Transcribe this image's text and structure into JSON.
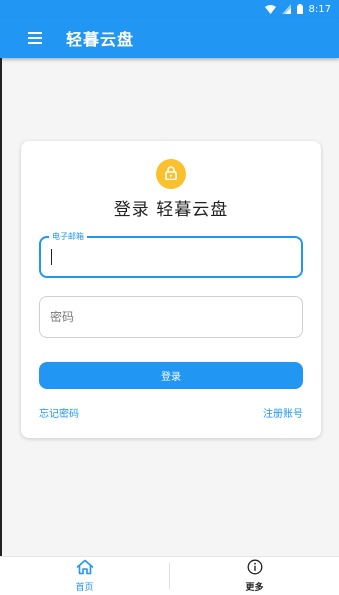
{
  "status_bar": {
    "time": "8:17",
    "icons": [
      "wifi-icon",
      "signal-icon",
      "battery-icon"
    ]
  },
  "app_bar": {
    "title": "轻暮云盘",
    "menu_icon": "menu-icon"
  },
  "login_card": {
    "lock_icon": "lock-icon",
    "title": "登录 轻暮云盘",
    "email": {
      "label": "电子邮箱",
      "value": ""
    },
    "password": {
      "placeholder": "密码",
      "value": ""
    },
    "login_button": "登录",
    "forgot_password": "忘记密码",
    "register": "注册账号"
  },
  "bottom_nav": {
    "items": [
      {
        "label": "首页",
        "icon": "home-icon",
        "active": true
      },
      {
        "label": "更多",
        "icon": "info-icon",
        "active": false
      }
    ]
  },
  "colors": {
    "primary": "#2196f3",
    "accent": "#fbc02d",
    "background": "#f5f5f5"
  }
}
